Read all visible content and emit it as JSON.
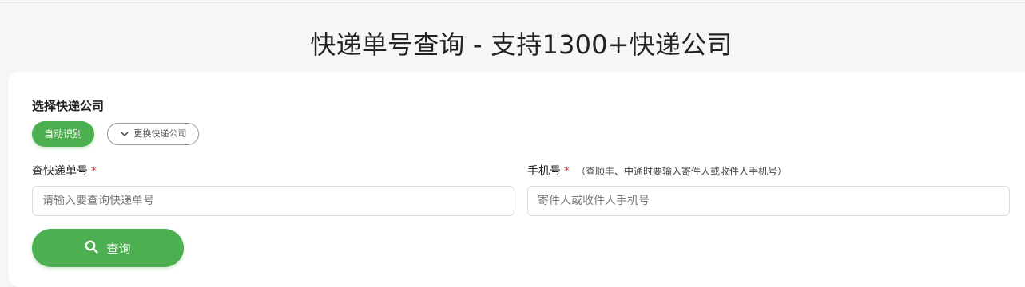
{
  "page": {
    "title": "快递单号查询 - 支持1300+快递公司"
  },
  "carrier": {
    "label": "选择快递公司",
    "auto_label": "自动识别",
    "change_label": "更换快递公司"
  },
  "tracking": {
    "label": "查快递单号",
    "required_mark": "*",
    "placeholder": "请输入要查询快递单号",
    "value": ""
  },
  "phone": {
    "label": "手机号",
    "required_mark": "*",
    "hint": "（查顺丰、中通时要输入寄件人或收件人手机号）",
    "placeholder": "寄件人或收件人手机号",
    "value": ""
  },
  "actions": {
    "search_label": "查询"
  },
  "icons": {
    "change": "chevron-down-icon",
    "search": "search-icon"
  },
  "colors": {
    "accent": "#4caf50",
    "required": "#e53935"
  }
}
